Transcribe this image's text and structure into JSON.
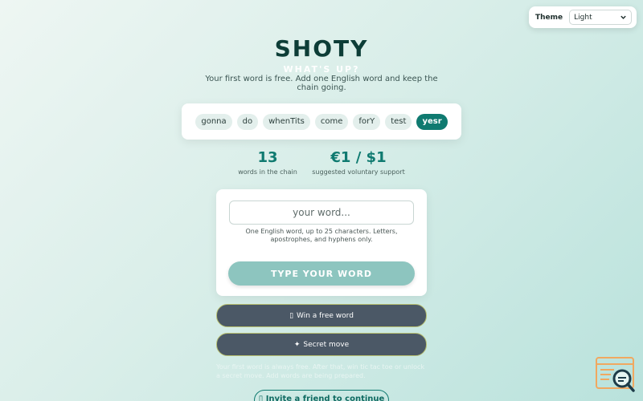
{
  "theme": {
    "label": "Theme",
    "selected": "Light"
  },
  "header": {
    "title": "SHOTY",
    "subtitle": "WHAT'S UP?",
    "intro": "Your first word is free. Add one English word and keep the chain going."
  },
  "chain": {
    "words": [
      "gonna",
      "do",
      "whenTits",
      "come",
      "forY",
      "test",
      "yesr"
    ]
  },
  "stats": {
    "words_count": "13",
    "words_label": "words in the chain",
    "support_value": "€1 / $1",
    "support_label": "suggested voluntary support"
  },
  "input": {
    "placeholder": "your word...",
    "hint": "One English word, up to 25 characters. Letters, apostrophes, and hyphens only.",
    "submit_label": "TYPE YOUR WORD"
  },
  "actions": {
    "win_icon": "▯",
    "win_label": "Win a free word",
    "secret_icon": "✦",
    "secret_label": "Secret move"
  },
  "footnote": "Your first word is always free. After that, win tic tac toe or unlock a secret move. Add words are being prepared.",
  "invite": {
    "icon": "▯",
    "label": "Invite a friend to continue"
  },
  "colors": {
    "accent": "#0f7a70",
    "button_dark": "#4b5866",
    "button_light": "#8dc5bf"
  }
}
